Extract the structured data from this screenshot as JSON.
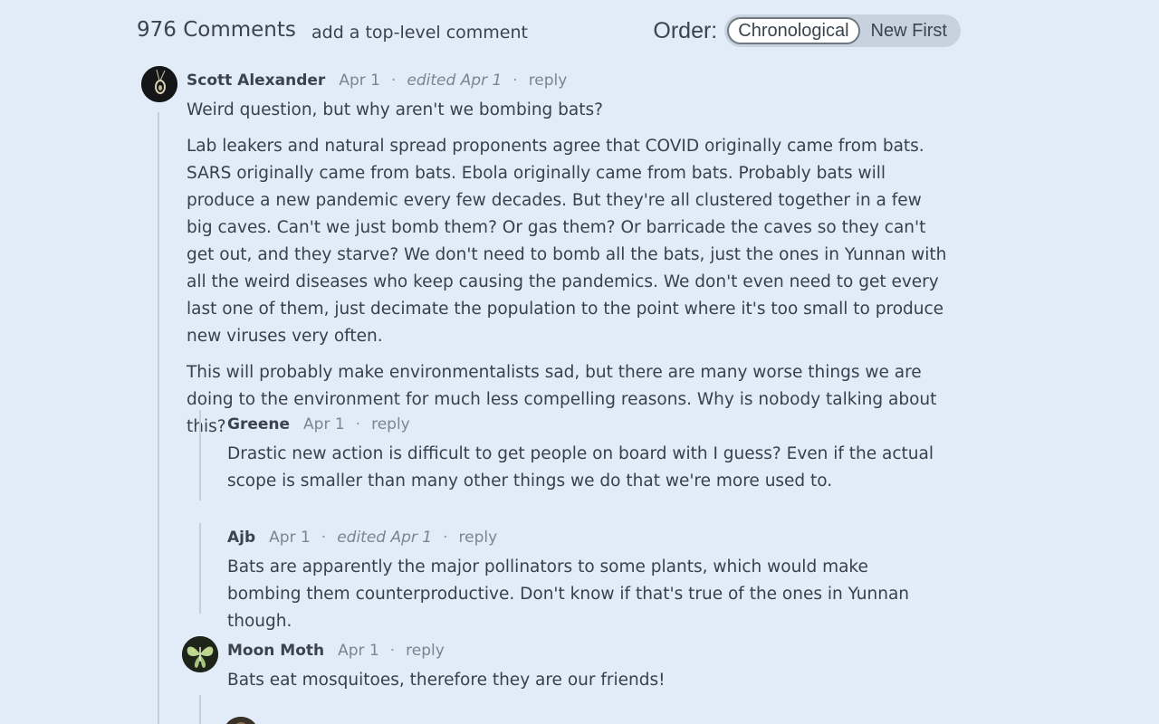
{
  "header": {
    "comment_count": "976 Comments",
    "add_comment": "add a top-level comment",
    "order_label": "Order:",
    "order_options": [
      "Chronological",
      "New First"
    ]
  },
  "comments": [
    {
      "author": "Scott Alexander",
      "date": "Apr 1",
      "separator": "·",
      "edited": "edited Apr 1",
      "reply": "reply",
      "paragraphs": [
        "Weird question, but why aren't we bombing bats?",
        "Lab leakers and natural spread proponents agree that COVID originally came from bats. SARS originally came from bats. Ebola originally came from bats. Probably bats will produce a new pandemic every few decades. But they're all clustered together in a few big caves. Can't we just bomb them? Or gas them? Or barricade the caves so they can't get out, and they starve? We don't need to bomb all the bats, just the ones in Yunnan with all the weird diseases who keep causing the pandemics. We don't even need to get every last one of them, just decimate the population to the point where it's too small to produce new viruses very often.",
        "This will probably make environmentalists sad, but there are many worse things we are doing to the environment for much less compelling reasons. Why is nobody talking about this?"
      ]
    },
    {
      "author": "Greene",
      "date": "Apr 1",
      "separator": "·",
      "reply": "reply",
      "paragraphs": [
        "Drastic new action is difficult to get people on board with I guess? Even if the actual scope is smaller than many other things we do that we're more used to."
      ]
    },
    {
      "author": "Ajb",
      "date": "Apr 1",
      "separator": "·",
      "edited": "edited Apr 1",
      "reply": "reply",
      "paragraphs": [
        "Bats are apparently the major pollinators to some plants, which would make bombing them counterproductive. Don't know if that's true of the ones in Yunnan though."
      ]
    },
    {
      "author": "Moon Moth",
      "date": "Apr 1",
      "separator": "·",
      "reply": "reply",
      "paragraphs": [
        "Bats eat mosquitoes, therefore they are our friends!"
      ]
    }
  ],
  "colors": {
    "background": "#e1ecf8",
    "text": "#38414b",
    "muted": "#7a8590",
    "thread_line": "#c5cfda"
  }
}
